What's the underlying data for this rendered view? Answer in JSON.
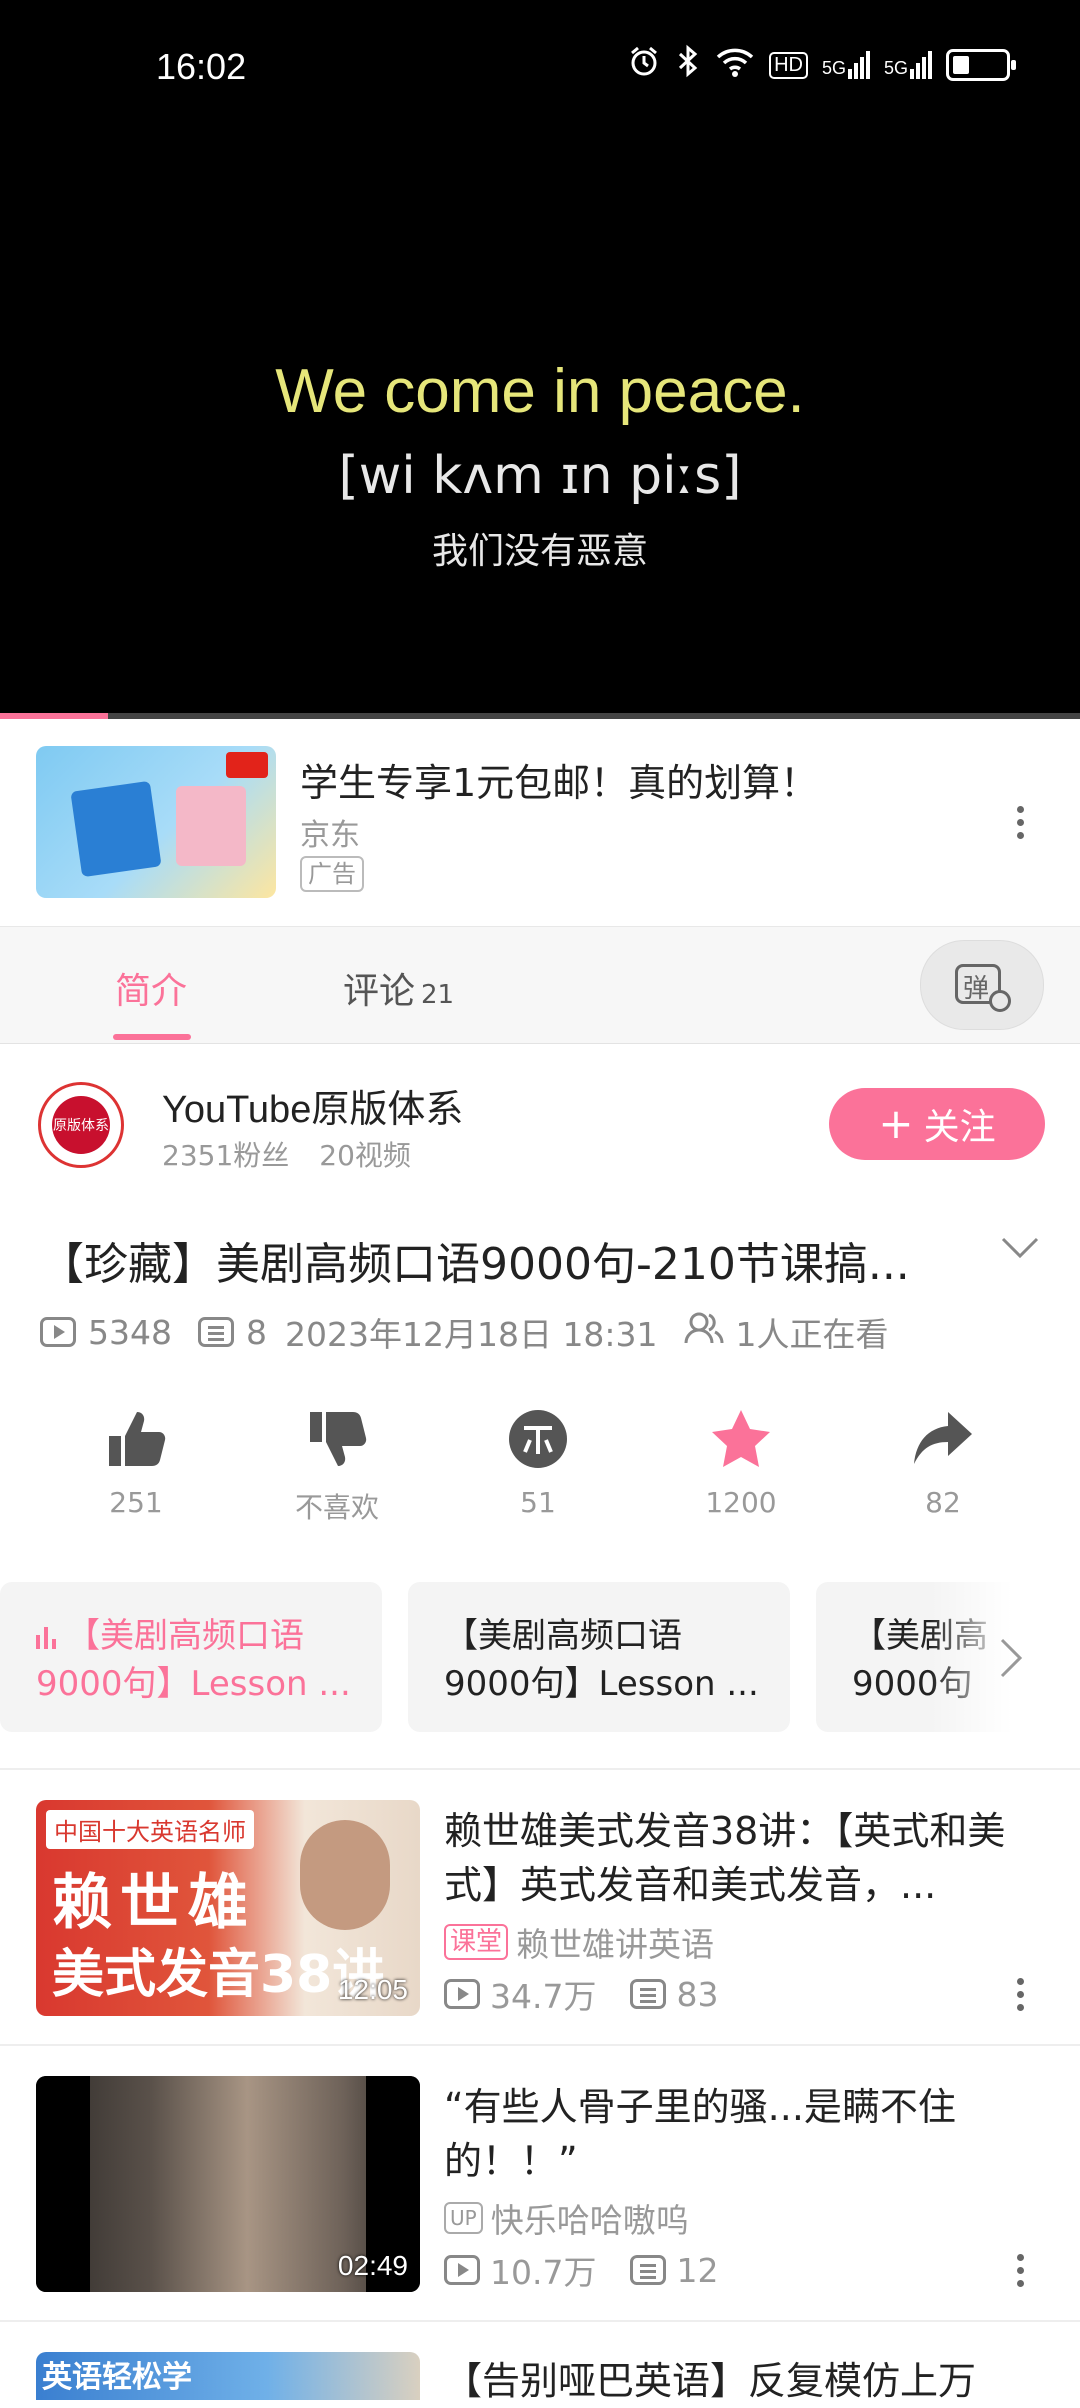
{
  "status_bar": {
    "time": "16:02",
    "net1": "HD",
    "net2": "5G",
    "net3": "5G"
  },
  "player": {
    "subtitle_en": "We come in peace.",
    "subtitle_ipa": "[wi kʌm ɪn piːs]",
    "subtitle_zh": "我们没有恶意",
    "progress_fraction": 0.1
  },
  "ad": {
    "title": "学生专享1元包邮！真的划算！",
    "source": "京东",
    "badge": "广告"
  },
  "tabs": {
    "intro": "简介",
    "comments": "评论",
    "comments_count": "21",
    "danmaku_glyph": "弹"
  },
  "uploader": {
    "name": "YouTube原版体系",
    "fans": "2351粉丝",
    "videos": "20视频",
    "avatar_text": "原版体系",
    "follow_label": "关注"
  },
  "video": {
    "title": "【珍藏】美剧高频口语9000句-210节课搞...",
    "plays": "5348",
    "danmaku": "8",
    "date": "2023年12月18日 18:31",
    "watching": "1人正在看"
  },
  "actions": {
    "like": "251",
    "dislike": "不喜欢",
    "coin": "51",
    "favorite": "1200",
    "share": "82"
  },
  "episodes": [
    {
      "line1": "【美剧高频口语",
      "line2": "9000句】Lesson ..."
    },
    {
      "line1": "【美剧高频口语",
      "line2": "9000句】Lesson ..."
    },
    {
      "line1": "【美剧高",
      "line2": "9000句"
    }
  ],
  "related": [
    {
      "title": "赖世雄美式发音38讲：【英式和美式】英式发音和美式发音，...",
      "tag": "课堂",
      "owner": "赖世雄讲英语",
      "views": "34.7万",
      "comments": "83",
      "duration": "12:05",
      "thumb_banner": "中国十大英语名师",
      "thumb_line1": "赖世雄",
      "thumb_line2": "美式发音38讲"
    },
    {
      "title": "“有些人骨子里的骚...是瞒不住的！！”",
      "tag": "UP",
      "owner": "快乐哈哈嗷呜",
      "views": "10.7万",
      "comments": "12",
      "duration": "02:49"
    },
    {
      "title": "【告别哑巴英语】反复模仿上万",
      "thumb_banner": "英语轻松学"
    }
  ],
  "colors": {
    "accent": "#fb7299",
    "text": "#222222",
    "muted": "#999999"
  }
}
